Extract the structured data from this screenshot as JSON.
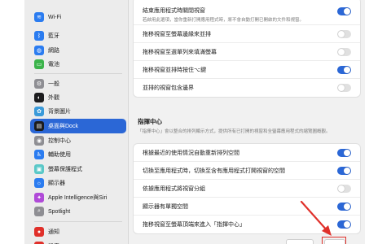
{
  "sidebar": {
    "items": [
      {
        "label": "Wi-Fi",
        "icon": "wifi-icon",
        "color": "#2b7cf0",
        "glyph": "≋"
      },
      {
        "label": "藍牙",
        "icon": "bluetooth-icon",
        "color": "#2b7cf0",
        "glyph": "ᛒ"
      },
      {
        "label": "網路",
        "icon": "globe-icon",
        "color": "#2b7cf0",
        "glyph": "◍"
      },
      {
        "label": "電池",
        "icon": "battery-icon",
        "color": "#3cb44b",
        "glyph": "▭"
      },
      {
        "label": "一般",
        "icon": "gear-icon",
        "color": "#8e8e93",
        "glyph": "⚙"
      },
      {
        "label": "外觀",
        "icon": "appearance-icon",
        "color": "#1c1c1e",
        "glyph": "◐"
      },
      {
        "label": "背景圖片",
        "icon": "wallpaper-icon",
        "color": "#3a9ad9",
        "glyph": "✿"
      },
      {
        "label": "桌面與Dock",
        "icon": "desktop-dock-icon",
        "color": "#1c1c1e",
        "glyph": "▤",
        "selected": true
      },
      {
        "label": "控制中心",
        "icon": "control-center-icon",
        "color": "#8e8e93",
        "glyph": "◉"
      },
      {
        "label": "輔助使用",
        "icon": "accessibility-icon",
        "color": "#2b7cf0",
        "glyph": "♿"
      },
      {
        "label": "螢幕保護程式",
        "icon": "screensaver-icon",
        "color": "#5ac8c8",
        "glyph": "▣"
      },
      {
        "label": "顯示器",
        "icon": "display-icon",
        "color": "#2b7cf0",
        "glyph": "☼"
      },
      {
        "label": "Apple Intelligence與Siri",
        "icon": "siri-icon",
        "color": "#b04ad8",
        "glyph": "✦"
      },
      {
        "label": "Spotlight",
        "icon": "spotlight-icon",
        "color": "#8e8e93",
        "glyph": "⌕"
      },
      {
        "label": "通知",
        "icon": "notifications-icon",
        "color": "#e0302a",
        "glyph": "●"
      },
      {
        "label": "聲音",
        "icon": "sound-icon",
        "color": "#e0302a",
        "glyph": "♪"
      }
    ]
  },
  "main": {
    "top_rows": [
      {
        "label": "結束應用程式時關閉視窗",
        "desc": "若啟用此選項，當你重新打開應用程式時，將不會自動打開已開啟的文件和視窗。",
        "on": true
      },
      {
        "label": "拖移視窗至螢幕邊緣來並排",
        "on": false
      },
      {
        "label": "拖移視窗至選單列來填滿螢幕",
        "on": false
      },
      {
        "label": "拖移視窗並排時按住⌥鍵",
        "on": true
      },
      {
        "label": "並排的視窗包含邊界",
        "on": false
      }
    ],
    "mission_control": {
      "title": "指揮中心",
      "desc": "「指揮中心」會以整合的排列顯示方式，提供所有已打開的視窗和全螢幕應用程式的縮覽圖概觀。"
    },
    "mc_rows": [
      {
        "label": "根據最近的使用情況自動重新排列空間",
        "on": true
      },
      {
        "label": "切換至應用程式時，切換至含有應用程式打開視窗的空間",
        "on": true
      },
      {
        "label": "依據應用程式將視窗分組",
        "on": false
      },
      {
        "label": "顯示器有單獨空間",
        "on": true
      },
      {
        "label": "拖移視窗至螢幕頂端來進入「指揮中心」",
        "on": true
      }
    ]
  },
  "colors": {
    "accent": "#2b67d6",
    "annotation": "#e0302a"
  }
}
